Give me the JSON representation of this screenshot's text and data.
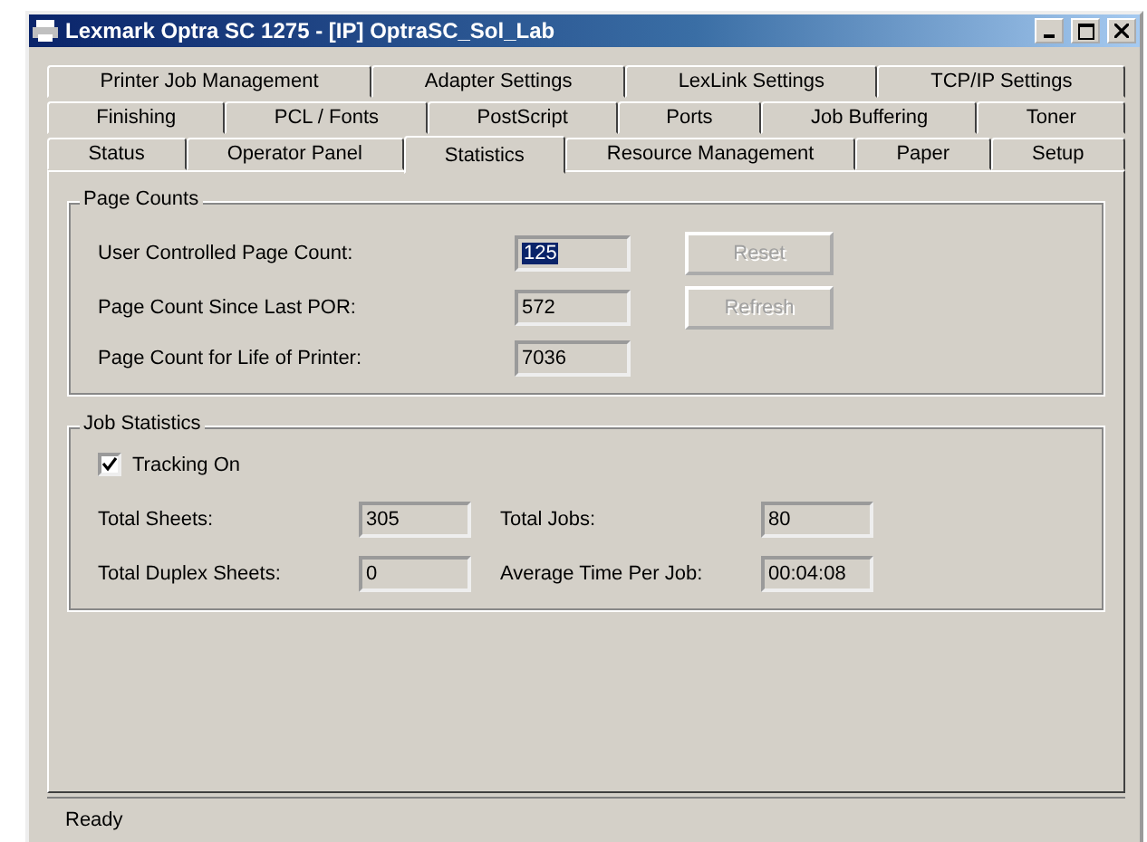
{
  "window": {
    "title": "Lexmark Optra SC 1275 - [IP] OptraSC_Sol_Lab"
  },
  "tab_rows": [
    [
      {
        "label": "Printer Job Management",
        "selected": false
      },
      {
        "label": "Adapter Settings",
        "selected": false
      },
      {
        "label": "LexLink Settings",
        "selected": false
      },
      {
        "label": "TCP/IP Settings",
        "selected": false
      }
    ],
    [
      {
        "label": "Finishing",
        "selected": false
      },
      {
        "label": "PCL / Fonts",
        "selected": false
      },
      {
        "label": "PostScript",
        "selected": false
      },
      {
        "label": "Ports",
        "selected": false
      },
      {
        "label": "Job Buffering",
        "selected": false
      },
      {
        "label": "Toner",
        "selected": false
      }
    ],
    [
      {
        "label": "Status",
        "selected": false
      },
      {
        "label": "Operator Panel",
        "selected": false
      },
      {
        "label": "Statistics",
        "selected": true
      },
      {
        "label": "Resource Management",
        "selected": false
      },
      {
        "label": "Paper",
        "selected": false
      },
      {
        "label": "Setup",
        "selected": false
      }
    ]
  ],
  "page_counts": {
    "title": "Page Counts",
    "fields": [
      {
        "label": "User Controlled Page Count:",
        "value": "125",
        "text_selected": true
      },
      {
        "label": "Page Count Since Last POR:",
        "value": "572",
        "text_selected": false
      },
      {
        "label": "Page Count for Life of Printer:",
        "value": "7036",
        "text_selected": false
      }
    ],
    "buttons": [
      {
        "label": "Reset",
        "disabled": true
      },
      {
        "label": "Refresh",
        "disabled": true
      }
    ]
  },
  "job_statistics": {
    "title": "Job Statistics",
    "tracking": {
      "label": "Tracking On",
      "checked": true
    },
    "fields": [
      {
        "label": "Total Sheets:",
        "value": "305"
      },
      {
        "label": "Total Jobs:",
        "value": "80"
      },
      {
        "label": "Total Duplex Sheets:",
        "value": "0"
      },
      {
        "label": "Average Time Per Job:",
        "value": "00:04:08"
      }
    ]
  },
  "status_bar": {
    "text": "Ready"
  }
}
